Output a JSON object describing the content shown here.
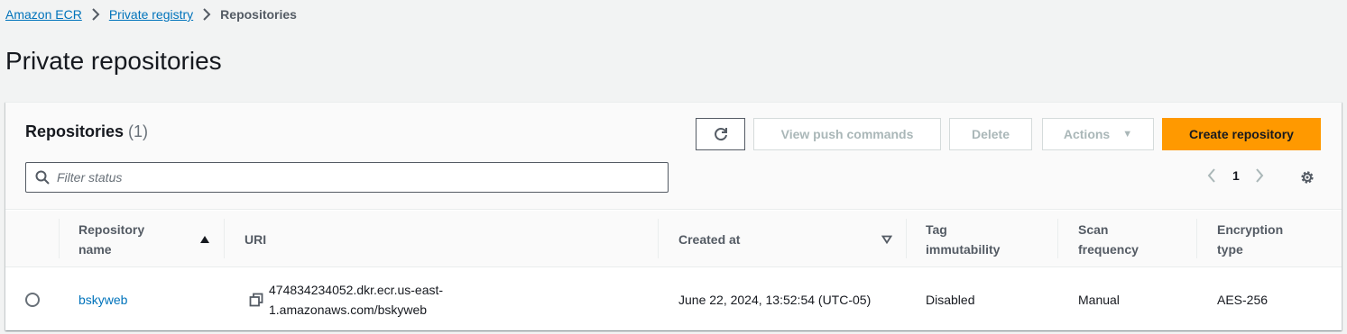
{
  "breadcrumb": {
    "items": [
      "Amazon ECR",
      "Private registry"
    ],
    "current": "Repositories"
  },
  "page": {
    "title": "Private repositories"
  },
  "panel": {
    "title": "Repositories",
    "count": "(1)",
    "buttons": {
      "push": "View push commands",
      "delete": "Delete",
      "actions": "Actions",
      "create": "Create repository"
    },
    "filter": {
      "placeholder": "Filter status",
      "value": ""
    },
    "pagination": {
      "page": "1"
    }
  },
  "table": {
    "columns": [
      "Repository name",
      "URI",
      "Created at",
      "Tag immutability",
      "Scan frequency",
      "Encryption type"
    ],
    "rows": [
      {
        "name": "bskyweb",
        "uri": "474834234052.dkr.ecr.us-east-1.amazonaws.com/bskyweb",
        "created": "June 22, 2024, 13:52:54 (UTC-05)",
        "tag_immutability": "Disabled",
        "scan_frequency": "Manual",
        "encryption": "AES-256"
      }
    ]
  },
  "colors": {
    "link": "#0073bb",
    "primary": "#ff9900",
    "text": "#16191f"
  },
  "icons": [
    "chevron-right-icon",
    "refresh-icon",
    "caret-down-icon",
    "search-icon",
    "chevron-left-icon",
    "settings-gear-icon",
    "sort-ascending-icon",
    "sort-descending-icon",
    "copy-icon"
  ]
}
